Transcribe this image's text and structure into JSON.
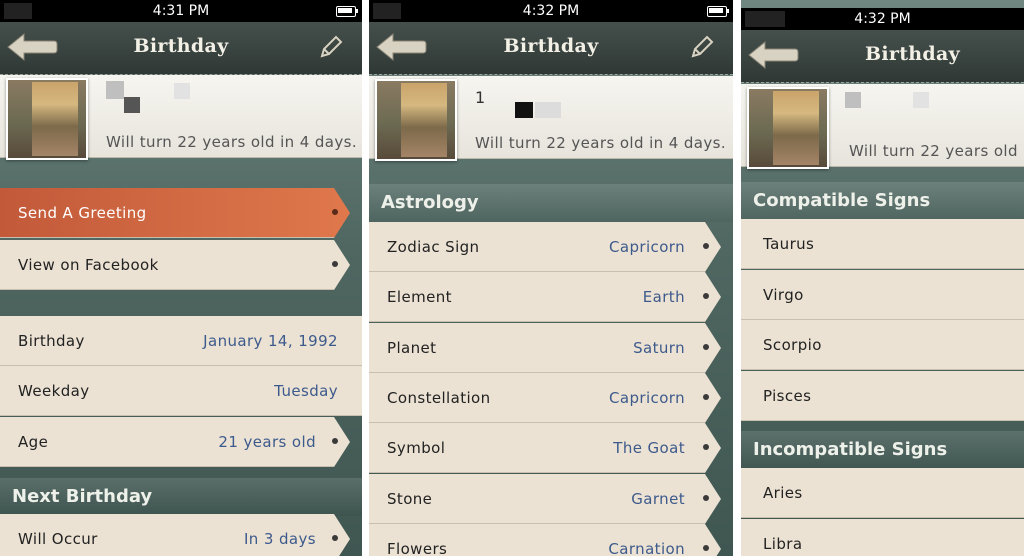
{
  "panels": [
    {
      "status_time": "4:31 PM",
      "nav_title": "Birthday",
      "profile": {
        "name_visible": "",
        "subtitle": "Will turn 22 years old in 4 days."
      },
      "actions": [
        {
          "label": "Send A Greeting",
          "highlighted": true
        },
        {
          "label": "View on Facebook",
          "highlighted": false
        }
      ],
      "details": [
        {
          "label": "Birthday",
          "value": "January 14, 1992"
        },
        {
          "label": "Weekday",
          "value": "Tuesday"
        },
        {
          "label": "Age",
          "value": "21 years old"
        }
      ],
      "next_section": "Next Birthday",
      "next_rows": [
        {
          "label": "Will Occur",
          "value": "In 3 days"
        }
      ]
    },
    {
      "status_time": "4:32 PM",
      "nav_title": "Birthday",
      "profile": {
        "name_visible": "1",
        "subtitle": "Will turn 22 years old in 4 days."
      },
      "section": "Astrology",
      "rows": [
        {
          "label": "Zodiac Sign",
          "value": "Capricorn"
        },
        {
          "label": "Element",
          "value": "Earth"
        },
        {
          "label": "Planet",
          "value": "Saturn"
        },
        {
          "label": "Constellation",
          "value": "Capricorn"
        },
        {
          "label": "Symbol",
          "value": "The Goat"
        },
        {
          "label": "Stone",
          "value": "Garnet"
        },
        {
          "label": "Flowers",
          "value": "Carnation"
        }
      ]
    },
    {
      "status_time": "4:32 PM",
      "nav_title": "Birthday",
      "profile": {
        "name_visible": "",
        "subtitle": "Will turn 22 years old"
      },
      "compatible_section": "Compatible Signs",
      "compatible": [
        "Taurus",
        "Virgo",
        "Scorpio",
        "Pisces"
      ],
      "incompatible_section": "Incompatible Signs",
      "incompatible": [
        "Aries",
        "Libra"
      ]
    }
  ],
  "icons": {
    "back": "back-arrow-icon",
    "edit": "pencil-icon",
    "battery": "battery-icon",
    "disclosure": "disclosure-dot-icon"
  },
  "colors": {
    "accent": "#d86a44",
    "value_text": "#3d5a8c",
    "row_bg": "#ebe2d3",
    "nav_bg": "#3a4541"
  }
}
